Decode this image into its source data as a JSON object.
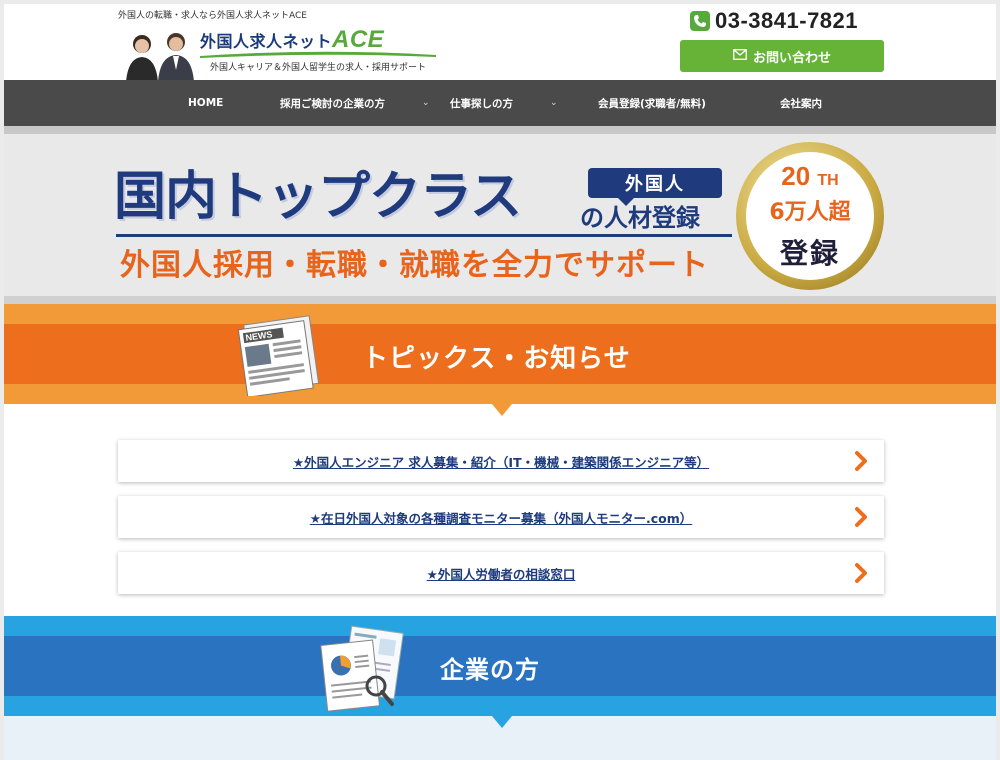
{
  "header": {
    "tagline": "外国人の転職・求人なら外国人求人ネットACE",
    "logo_title": "外国人求人ネット",
    "logo_ace": "ACE",
    "logo_subtitle": "外国人キャリア＆外国人留学生の求人・採用サポート",
    "phone": "03-3841-7821",
    "contact_button": "お問い合わせ"
  },
  "nav": {
    "items": [
      {
        "label": "HOME"
      },
      {
        "label": "採用ご検討の企業の方"
      },
      {
        "label": "仕事探しの方"
      },
      {
        "label": "会員登録(求職者/無料)"
      },
      {
        "label": "会社案内"
      }
    ]
  },
  "hero": {
    "headline": "国内トップクラス",
    "tag_top": "外国人",
    "tag_bottom": "の人材登録",
    "subline": "外国人採用・転職・就職を全力でサポート",
    "badge_line1": "20",
    "badge_line1_suffix": "TH",
    "badge_line2": "6万人超",
    "badge_line3": "登録"
  },
  "topics": {
    "title": "トピックス・お知らせ",
    "news_label": "NEWS",
    "items": [
      {
        "text": "★外国人エンジニア 求人募集・紹介（IT・機械・建築関係エンジニア等）"
      },
      {
        "text": "★在日外国人対象の各種調査モニター募集（外国人モニター.com）"
      },
      {
        "text": "★外国人労働者の相談窓口"
      }
    ]
  },
  "company": {
    "title": "企業の方"
  },
  "colors": {
    "nav_bg": "#4a4a4a",
    "brand_green": "#66b337",
    "brand_navy": "#1f3b7d",
    "accent_orange": "#ed6e1d",
    "accent_blue": "#2a73c1"
  }
}
